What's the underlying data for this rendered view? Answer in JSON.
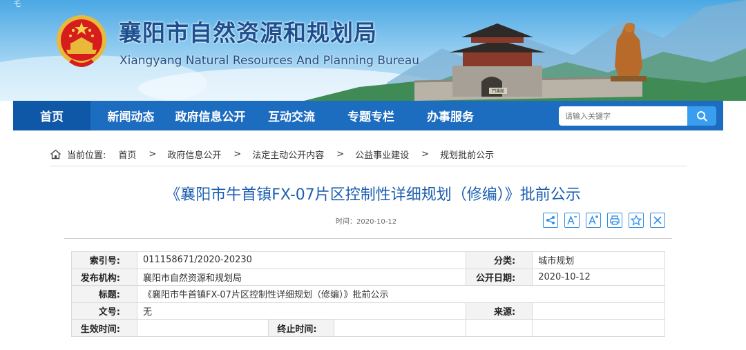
{
  "banner": {
    "corner_char": "乇",
    "title": "襄阳市自然资源和规划局",
    "subtitle": "Xiangyang Natural Resources And Planning Bureau",
    "gate_plaque": "鬥溪館"
  },
  "nav": {
    "items": [
      "首页",
      "新闻动态",
      "政府信息公开",
      "互动交流",
      "专题专栏",
      "办事服务"
    ],
    "active_index": 0,
    "search_placeholder": "请输入关键字",
    "colors": {
      "bar": "#1c6cc0",
      "active": "#0f58a8",
      "search_button": "#3a9ef0"
    }
  },
  "breadcrumb": {
    "label": "当前位置:",
    "items": [
      "首页",
      "政府信息公开",
      "法定主动公开内容",
      "公益事业建设",
      "规划批前公示"
    ],
    "separator": ">"
  },
  "article": {
    "title": "《襄阳市牛首镇FX-07片区控制性详细规划（修编）》批前公示",
    "time": "时间：2020-10-12",
    "title_color": "#1c5fb0",
    "tool_icons": [
      "share-icon",
      "font-decrease-icon",
      "font-increase-icon",
      "print-icon",
      "star-icon",
      "close-icon"
    ]
  },
  "info": {
    "index_no": {
      "label": "索引号:",
      "value": "011158671/2020-20230"
    },
    "category": {
      "label": "分类:",
      "value": "城市规划"
    },
    "publisher": {
      "label": "发布机构:",
      "value": "襄阳市自然资源和规划局"
    },
    "publish_date": {
      "label": "公开日期:",
      "value": "2020-10-12"
    },
    "title": {
      "label": "标题:",
      "value": "《襄阳市牛首镇FX-07片区控制性详细规划（修编）》批前公示"
    },
    "doc_no": {
      "label": "文号:",
      "value": "无"
    },
    "source": {
      "label": "来源:",
      "value": ""
    },
    "effective_time": {
      "label": "生效时间:",
      "value": ""
    },
    "end_time": {
      "label": "终止时间:",
      "value": ""
    }
  }
}
